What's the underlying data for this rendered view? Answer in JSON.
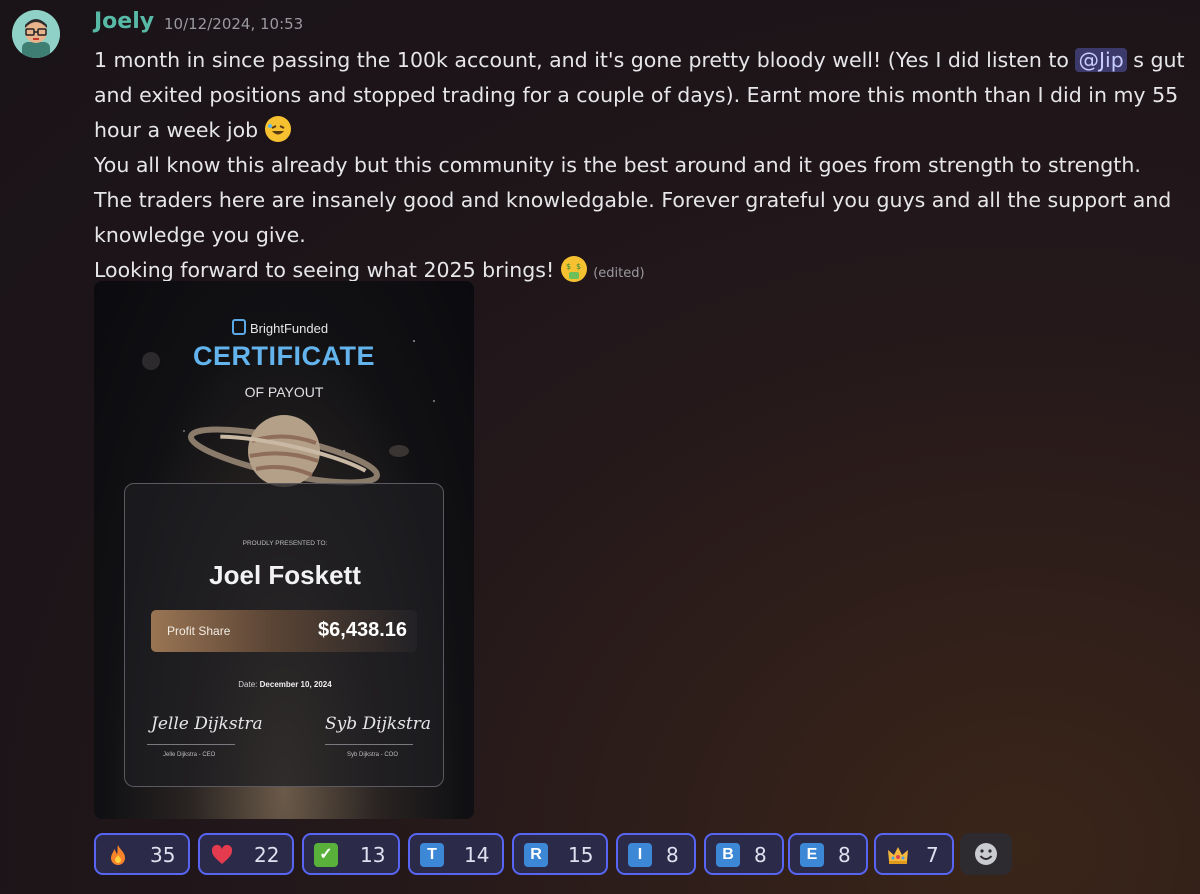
{
  "message": {
    "author": "Joely",
    "timestamp": "10/12/2024, 10:53",
    "lines": [
      "1 month in since passing the 100k account, and it's gone pretty bloody well! (Yes I did listen to ",
      " s gut",
      "and exited positions and stopped trading for a couple of days). Earnt more this month than I did in my 55",
      "hour a week job",
      "You all know this already but this community is the best around and it goes from strength to strength.",
      "The traders here are insanely good and knowledgable. Forever grateful you guys and all the support and",
      "knowledge you give.",
      "Looking forward to seeing what 2025 brings!"
    ],
    "mention": "@Jip",
    "edited_label": "(edited)"
  },
  "certificate": {
    "brand": "BrightFunded",
    "title": "CERTIFICATE",
    "subtitle": "OF PAYOUT",
    "presented_label": "PROUDLY PRESENTED TO:",
    "recipient": "Joel Foskett",
    "profit_label": "Profit Share",
    "profit_value": "$6,438.16",
    "date_label": "Date:",
    "date_value": "December 10, 2024",
    "signature_left": "Jelle Dijkstra",
    "signer_left": "Jelle Dijkstra - CEO",
    "signature_right": "Syb Dijkstra",
    "signer_right": "Syb Dijkstra - COO"
  },
  "reactions": [
    {
      "icon": "fire-icon",
      "count": "35"
    },
    {
      "icon": "heart-icon",
      "count": "22"
    },
    {
      "icon": "check-mark-icon",
      "count": "13",
      "letter": "✓"
    },
    {
      "icon": "letter-t-icon",
      "count": "14",
      "letter": "T"
    },
    {
      "icon": "letter-r-icon",
      "count": "15",
      "letter": "R"
    },
    {
      "icon": "letter-i-icon",
      "count": "8",
      "letter": "I"
    },
    {
      "icon": "letter-b-icon",
      "count": "8",
      "letter": "B"
    },
    {
      "icon": "letter-e-icon",
      "count": "8",
      "letter": "E"
    },
    {
      "icon": "crown-icon",
      "count": "7"
    }
  ],
  "colors": {
    "accent": "#5865f2",
    "username": "#58b9a6",
    "reaction_bg": "#2b2a49",
    "letter_tile": "#3c88d6",
    "check_tile": "#59b13c",
    "certificate_title": "#63b3ed"
  }
}
